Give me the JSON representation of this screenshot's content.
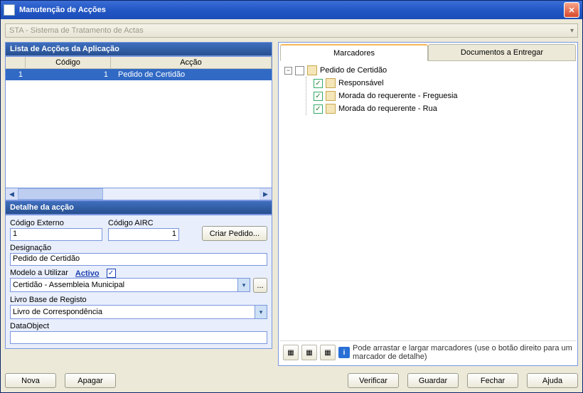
{
  "window": {
    "title": "Manutenção de Acções"
  },
  "appcombo": {
    "text": "STA - Sistema de Tratamento de Actas"
  },
  "listPanel": {
    "title": "Lista de Acções da Aplicação",
    "columns": {
      "code": "Código",
      "action": "Acção"
    },
    "rows": [
      {
        "num": "1",
        "code": "1",
        "action": "Pedido de Certidão"
      }
    ]
  },
  "detailPanel": {
    "title": "Detalhe da acção",
    "labels": {
      "codigoExterno": "Código Externo",
      "codigoAIRC": "Código AIRC",
      "criarPedido": "Criar Pedido...",
      "designacao": "Designação",
      "modelo": "Modelo a Utilizar",
      "activo": "Activo",
      "livro": "Livro Base de Registo",
      "dataobject": "DataObject"
    },
    "values": {
      "codigoExterno": "1",
      "codigoAIRC": "1",
      "designacao": "Pedido de Certidão",
      "modelo": "Certidão - Assembleia Municipal",
      "livro": "Livro de Correspondência",
      "dataobject": "",
      "activoChecked": "✓"
    }
  },
  "tabs": {
    "marcadores": "Marcadores",
    "documentos": "Documentos a Entregar"
  },
  "tree": {
    "root": {
      "label": "Pedido de Certidão"
    },
    "children": [
      {
        "label": "Responsável"
      },
      {
        "label": "Morada do requerente - Freguesia"
      },
      {
        "label": "Morada do requerente - Rua"
      }
    ]
  },
  "hint": "Pode arrastar e largar marcadores (use o botão direito para um marcador de detalhe)",
  "buttons": {
    "nova": "Nova",
    "apagar": "Apagar",
    "verificar": "Verificar",
    "guardar": "Guardar",
    "fechar": "Fechar",
    "ajuda": "Ajuda"
  }
}
